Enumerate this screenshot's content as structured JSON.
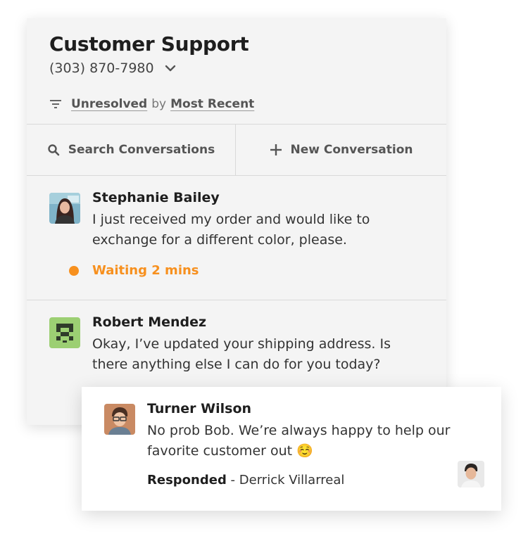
{
  "header": {
    "title": "Customer Support",
    "phone": "(303) 870-7980",
    "filter": {
      "status": "Unresolved",
      "by": "by",
      "sort": "Most Recent"
    }
  },
  "actions": {
    "search_label": "Search Conversations",
    "new_label": "New Conversation"
  },
  "conversations": [
    {
      "name": "Stephanie Bailey",
      "message": "I just received my order and would like to exchange for a different color, please.",
      "status": "Waiting 2 mins",
      "status_color": "#f7901e"
    },
    {
      "name": "Robert Mendez",
      "message": "Okay, I’ve updated your shipping address. Is there anything else I can do for you today?"
    }
  ],
  "highlight_card": {
    "name": "Turner Wilson",
    "message": "No prob Bob. We’re always happy to help our favorite customer out ☺️",
    "responded_label": "Responded",
    "separator": " - ",
    "responder": "Derrick Villarreal"
  },
  "icons": [
    "chevron-down-icon",
    "filter-icon",
    "search-icon",
    "plus-icon"
  ],
  "colors": {
    "panel_bg": "#f4f4f4",
    "waiting_orange": "#f7901e",
    "avatar_green": "#9ccf73"
  }
}
